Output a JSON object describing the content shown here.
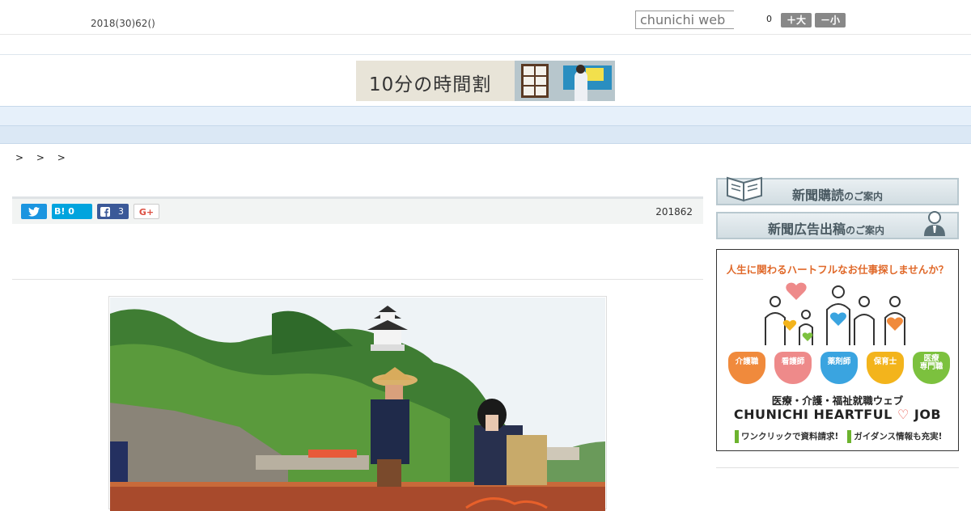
{
  "header": {
    "date": "2018(30)62()",
    "search_placeholder": "chunichi web",
    "font_size_value": "0",
    "font_larger_label": "＋大",
    "font_smaller_label": "－小"
  },
  "banner": {
    "text": "10分の時間割"
  },
  "nav": {
    "items": [
      "",
      "",
      "",
      "",
      "",
      "",
      "",
      "",
      ""
    ]
  },
  "breadcrumb": {
    "text": "> > >"
  },
  "share": {
    "hatena_label": "B!",
    "hatena_count": "0",
    "facebook_count": "3",
    "gplus_label": "G+"
  },
  "article": {
    "date": "201862"
  },
  "sidebar": {
    "subscribe_main": "新聞購読",
    "subscribe_sub": "のご案内",
    "ad_main": "新聞広告出稿",
    "ad_sub": "のご案内"
  },
  "job_ad": {
    "headline": "人生に関わるハートフルなお仕事探しませんか？",
    "hearts": [
      {
        "label": "介護職",
        "color": "#f08a3c"
      },
      {
        "label": "看護師",
        "color": "#ee8a8a"
      },
      {
        "label": "薬剤師",
        "color": "#3aa4e0"
      },
      {
        "label": "保育士",
        "color": "#f3b41c"
      },
      {
        "label": "医療\n専門職",
        "color": "#7cc13e"
      }
    ],
    "title": "医療・介護・福祉就職ウェブ",
    "brand": "CHUNICHI HEARTFUL",
    "brand_suffix": "JOB",
    "tag1": "ワンクリックで資料請求!",
    "tag2": "ガイダンス情報も充実!"
  },
  "colors": {
    "twitter": "#1b95e0",
    "hatena": "#00a4de",
    "facebook": "#3b5998",
    "nav_bg": "#e6f0fa"
  }
}
